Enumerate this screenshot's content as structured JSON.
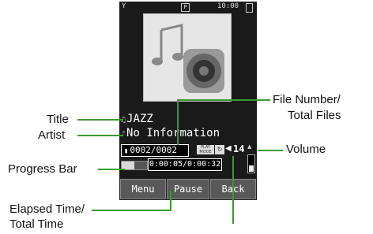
{
  "phone": {
    "status": {
      "signal": "Y",
      "p_icon": "P",
      "time": "10:00"
    },
    "track": {
      "title": "JAZZ",
      "artist": "No Information"
    },
    "file_number": "0002/0002",
    "play_mode": "PLAY MODE",
    "repeat_icon": "repeat-icon",
    "volume": "14",
    "progress_fraction": 0.5,
    "elapsed_total": "0:00:05/0:00:32",
    "softkeys": {
      "left": "Menu",
      "center": "Pause",
      "right": "Back"
    }
  },
  "callouts": {
    "title": "Title",
    "artist": "Artist",
    "progress_bar": "Progress Bar",
    "elapsed_time_line1": "Elapsed Time/",
    "elapsed_time_line2": "Total Time",
    "file_number_line1": "File Number/",
    "file_number_line2": "Total Files",
    "volume": "Volume"
  },
  "colors": {
    "callout_line": "#3a9a2e",
    "screen_bg": "#1a1a1a",
    "softkey_bg": "#595959"
  }
}
